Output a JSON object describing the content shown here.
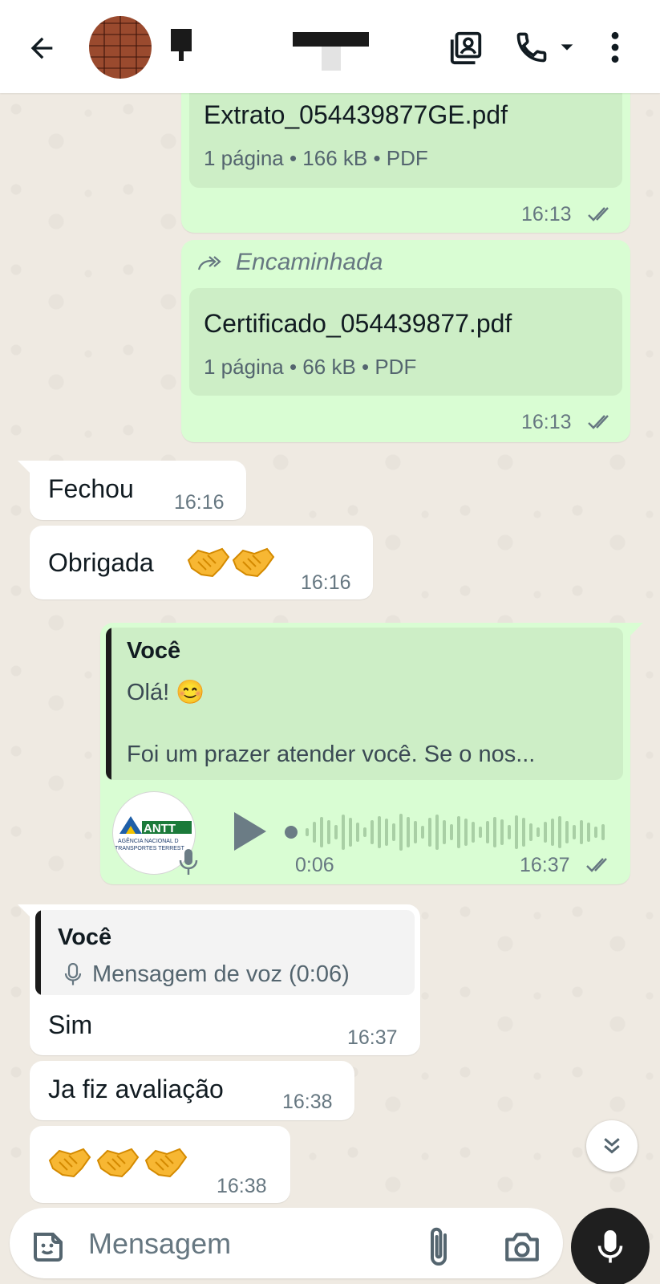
{
  "header": {
    "back_icon": "arrow-back-icon",
    "contact_info_icon": "contact-card-icon",
    "call_icon": "phone-icon",
    "dropdown_icon": "caret-down-icon",
    "menu_icon": "more-vert-icon"
  },
  "messages": {
    "doc1": {
      "name": "Extrato_054439877GE.pdf",
      "meta": "1 página • 166 kB • PDF",
      "time": "16:13"
    },
    "doc2": {
      "forwarded_label": "Encaminhada",
      "name": "Certificado_054439877.pdf",
      "meta": "1 página • 66 kB • PDF",
      "time": "16:13"
    },
    "in1": {
      "text": "Fechou",
      "time": "16:16"
    },
    "in2": {
      "text": "Obrigada",
      "time": "16:16"
    },
    "voice_reply": {
      "quote_author": "Você",
      "quote_line1": "Olá! 😊",
      "quote_line2": "Foi um prazer atender você. Se o nos...",
      "duration": "0:06",
      "time": "16:37",
      "avatar_text": "ANTT",
      "avatar_subtext1": "AGÊNCIA NACIONAL D",
      "avatar_subtext2": "TRANSPORTES TERREST"
    },
    "in3": {
      "quote_author": "Você",
      "quote_text": "Mensagem de voz (0:06)",
      "text": "Sim",
      "time": "16:37"
    },
    "in4": {
      "text": "Ja fiz avaliação",
      "time": "16:38"
    },
    "in5": {
      "time": "16:38"
    }
  },
  "composer": {
    "placeholder": "Mensagem"
  },
  "colors": {
    "outgoing_bubble": "#d9fdd3",
    "incoming_bubble": "#ffffff",
    "chat_background": "#efeae2",
    "ticks": "#667781"
  }
}
